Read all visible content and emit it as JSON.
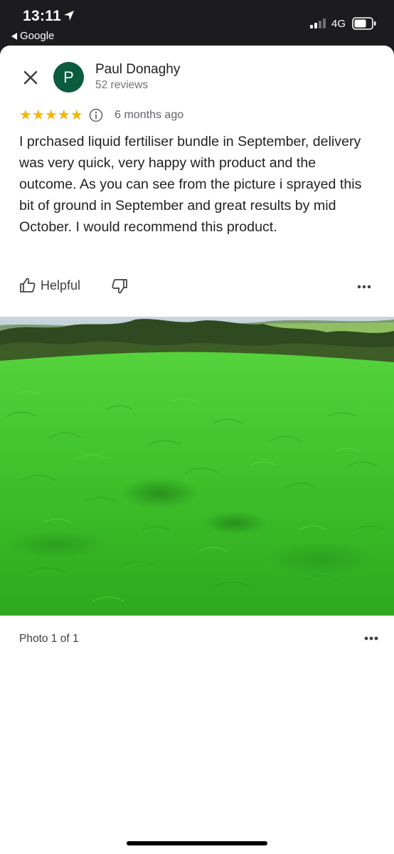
{
  "status_bar": {
    "time": "13:11",
    "back_app": "Google",
    "network": "4G"
  },
  "review": {
    "author_initial": "P",
    "author_name": "Paul Donaghy",
    "author_reviews": "52 reviews",
    "rating": 5,
    "stars": "★★★★★",
    "time_ago": "6 months ago",
    "text": "I prchased liquid fertiliser bundle in September, delivery was very quick, very happy with product and the outcome. As you can see from the picture i sprayed this bit of ground in September and great results by mid October. I would recommend this product.",
    "helpful_label": "Helpful"
  },
  "photo": {
    "counter": "Photo 1 of 1"
  },
  "colors": {
    "avatar": "#0b5b3f",
    "star": "#f5b400",
    "status_bar_bg": "#1c1c1e",
    "grass": "#3cc22a"
  },
  "icons": {
    "close": "close-icon",
    "info": "info-icon",
    "helpful": "thumb-up-icon",
    "dislike": "thumb-down-icon",
    "more": "more-horizontal-icon",
    "location": "location-arrow-icon"
  }
}
